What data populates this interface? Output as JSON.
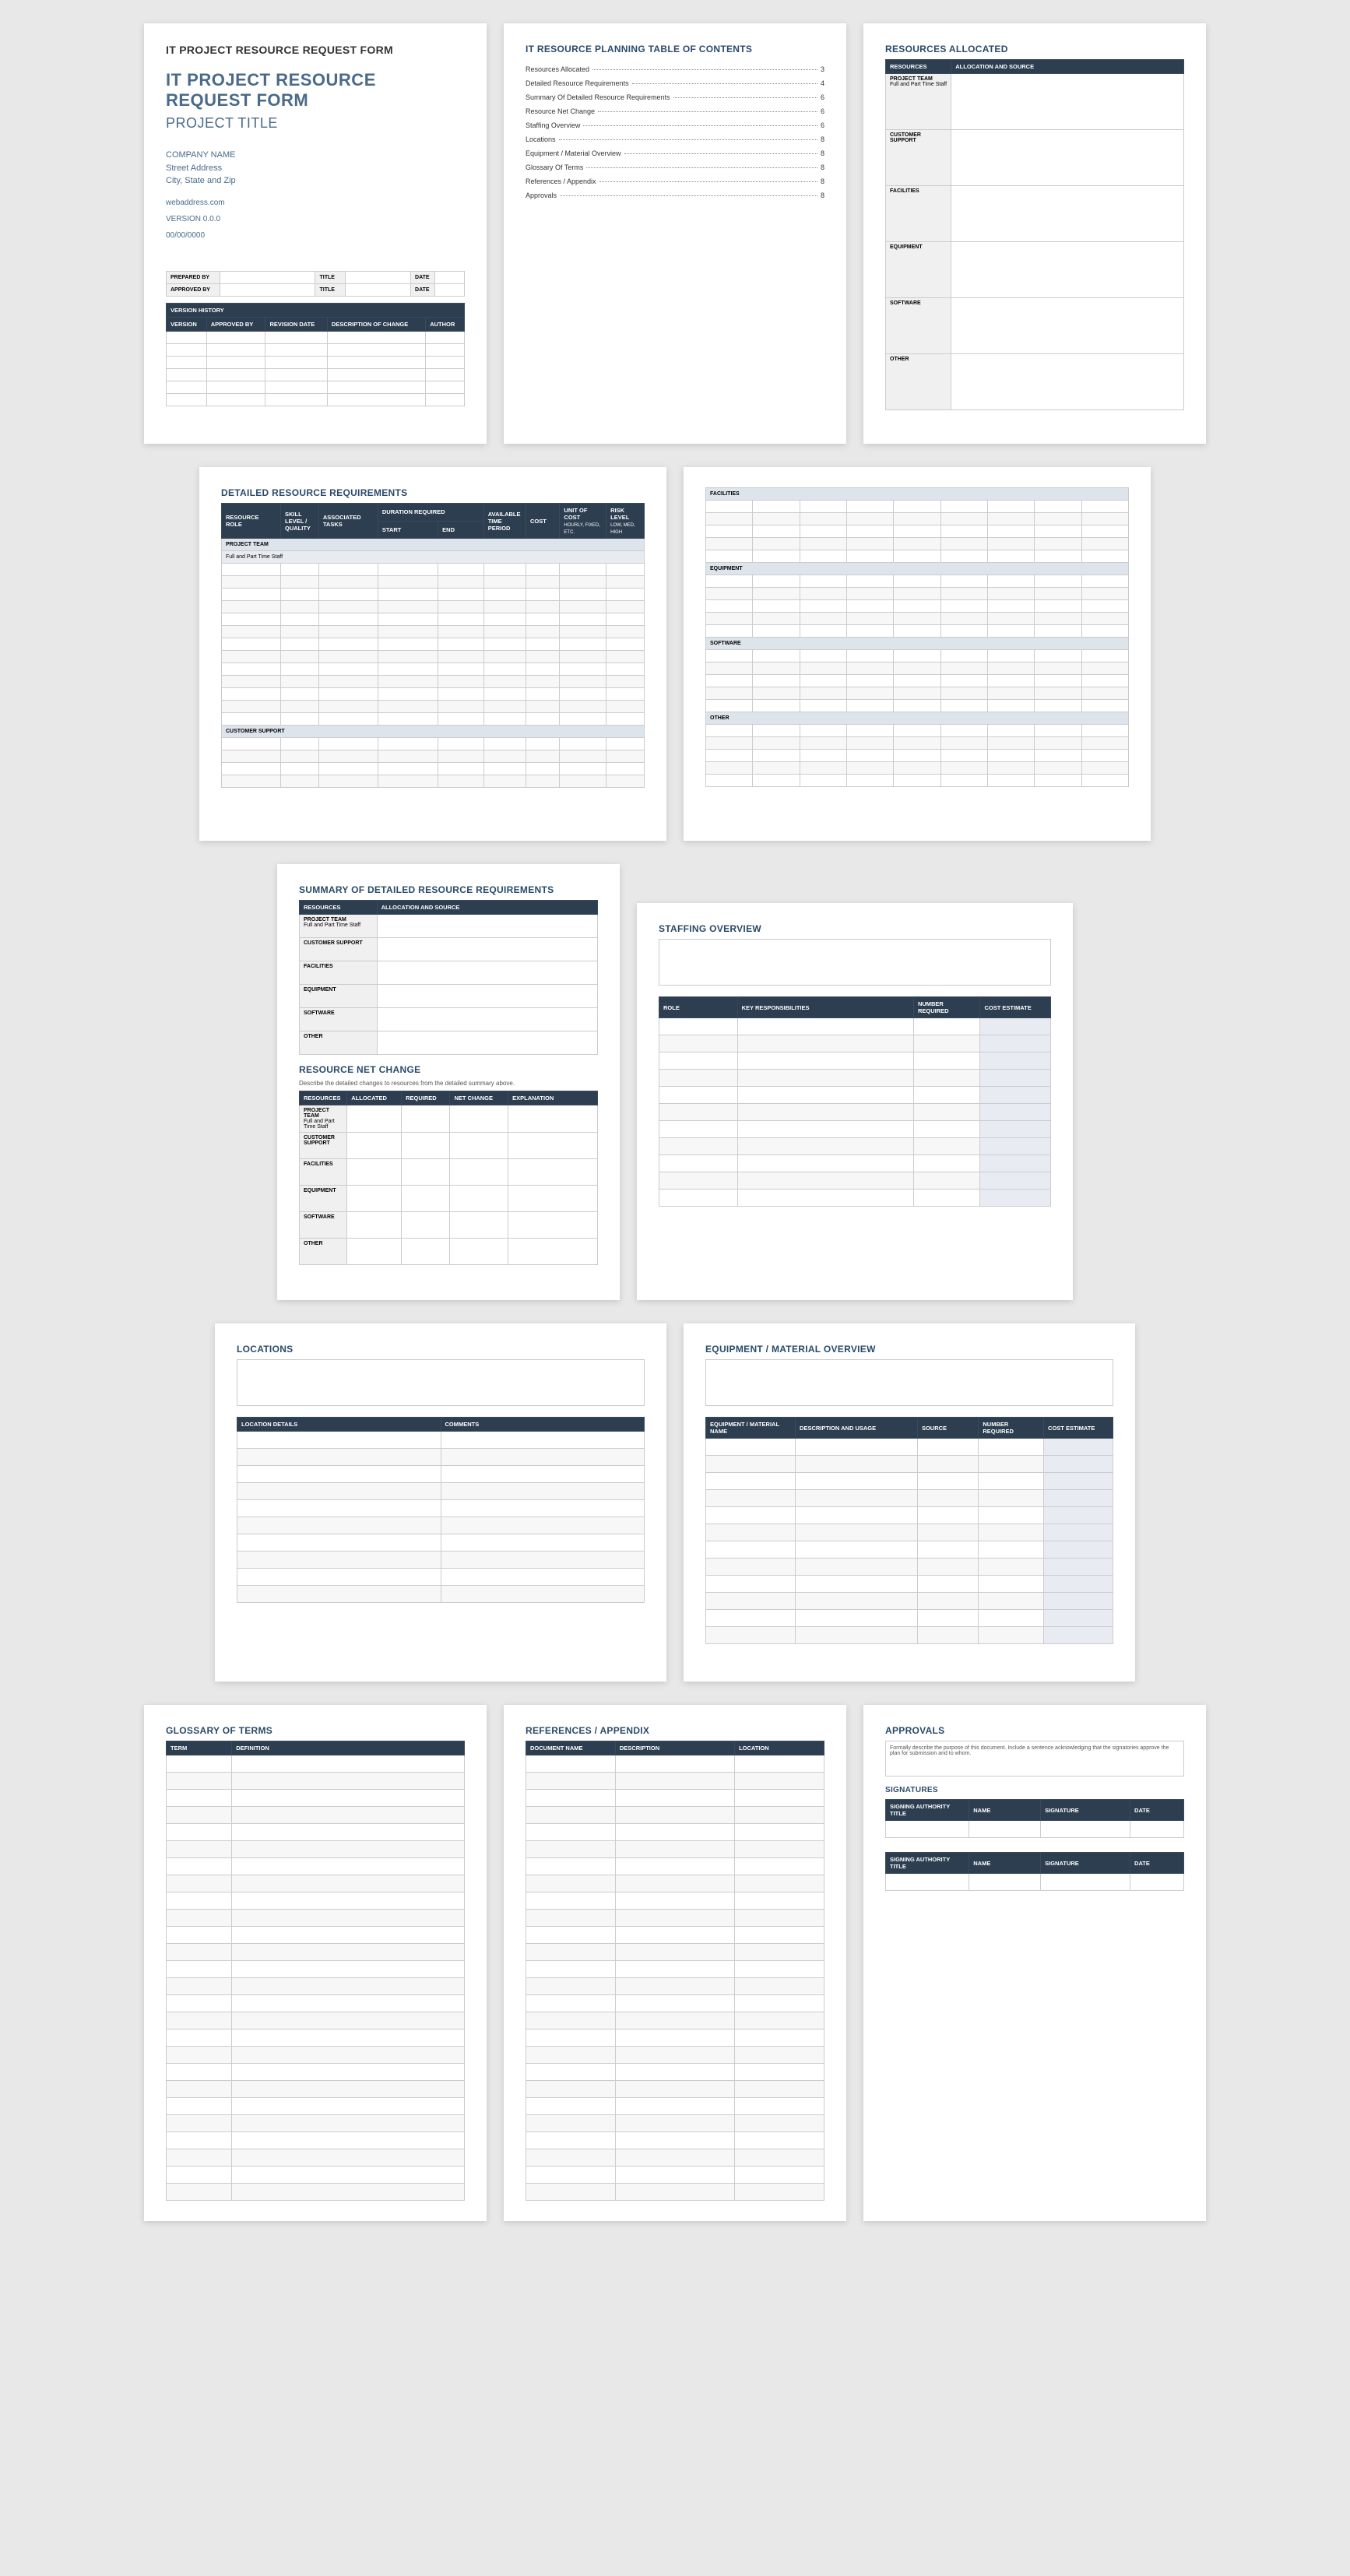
{
  "p1": {
    "head": "IT PROJECT RESOURCE REQUEST FORM",
    "title": "IT PROJECT RESOURCE REQUEST FORM",
    "project": "PROJECT TITLE",
    "company": "COMPANY NAME",
    "street": "Street Address",
    "city": "City, State and Zip",
    "web": "webaddress.com",
    "version": "VERSION 0.0.0",
    "date": "00/00/0000",
    "prep": "PREPARED BY",
    "t1": "TITLE",
    "d1": "DATE",
    "appr": "APPROVED BY",
    "t2": "TITLE",
    "d2": "DATE",
    "vh": "VERSION HISTORY",
    "vh_cols": [
      "VERSION",
      "APPROVED BY",
      "REVISION DATE",
      "DESCRIPTION OF CHANGE",
      "AUTHOR"
    ]
  },
  "p2": {
    "title": "IT RESOURCE PLANNING TABLE OF CONTENTS",
    "items": [
      {
        "t": "Resources Allocated",
        "n": "3"
      },
      {
        "t": "Detailed Resource Requirements",
        "n": "4"
      },
      {
        "t": "Summary Of Detailed Resource Requirements",
        "n": "6"
      },
      {
        "t": "Resource Net Change",
        "n": "6"
      },
      {
        "t": "Staffing Overview",
        "n": "6"
      },
      {
        "t": "Locations",
        "n": "8"
      },
      {
        "t": "Equipment / Material Overview",
        "n": "8"
      },
      {
        "t": "Glossary Of Terms",
        "n": "8"
      },
      {
        "t": "References / Appendix",
        "n": "8"
      },
      {
        "t": "Approvals",
        "n": "8"
      }
    ]
  },
  "p3": {
    "title": "RESOURCES ALLOCATED",
    "c1": "RESOURCES",
    "c2": "ALLOCATION AND SOURCE",
    "rows": [
      "PROJECT TEAM",
      "CUSTOMER SUPPORT",
      "FACILITIES",
      "EQUIPMENT",
      "SOFTWARE",
      "OTHER"
    ],
    "sub": "Full and Part Time Staff"
  },
  "p4": {
    "title": "DETAILED RESOURCE REQUIREMENTS",
    "cols": [
      "RESOURCE ROLE",
      "SKILL LEVEL / QUALITY",
      "ASSOCIATED TASKS",
      "DURATION REQUIRED",
      "",
      "AVAILABLE TIME PERIOD",
      "COST",
      "UNIT OF COST",
      "RISK LEVEL"
    ],
    "sub_start": "START",
    "sub_end": "END",
    "unit_hint": "Hourly, Fixed, etc.",
    "risk_hint": "Low, Med, High",
    "g1": "PROJECT TEAM",
    "g1s": "Full and Part Time Staff",
    "g2": "CUSTOMER SUPPORT"
  },
  "p5": {
    "g1": "FACILITIES",
    "g2": "EQUIPMENT",
    "g3": "SOFTWARE",
    "g4": "OTHER"
  },
  "p6": {
    "t1": "SUMMARY OF DETAILED RESOURCE REQUIREMENTS",
    "c1": "RESOURCES",
    "c2": "ALLOCATION AND SOURCE",
    "rows": [
      "PROJECT TEAM",
      "CUSTOMER SUPPORT",
      "FACILITIES",
      "EQUIPMENT",
      "SOFTWARE",
      "OTHER"
    ],
    "sub": "Full and Part Time Staff",
    "t2": "RESOURCE NET CHANGE",
    "t2s": "Describe the detailed changes to resources from the detailed summary above.",
    "nc": [
      "RESOURCES",
      "ALLOCATED",
      "REQUIRED",
      "NET CHANGE",
      "EXPLANATION"
    ],
    "ncrows": [
      "PROJECT TEAM",
      "CUSTOMER SUPPORT",
      "FACILITIES",
      "EQUIPMENT",
      "SOFTWARE",
      "OTHER"
    ],
    "ncsub": "Full and Part Time Staff"
  },
  "p7": {
    "title": "STAFFING OVERVIEW",
    "cols": [
      "ROLE",
      "KEY RESPONSIBILITIES",
      "NUMBER REQUIRED",
      "COST ESTIMATE"
    ]
  },
  "p8": {
    "title": "LOCATIONS",
    "cols": [
      "LOCATION DETAILS",
      "COMMENTS"
    ]
  },
  "p9": {
    "title": "EQUIPMENT / MATERIAL OVERVIEW",
    "cols": [
      "EQUIPMENT / MATERIAL NAME",
      "DESCRIPTION AND USAGE",
      "SOURCE",
      "NUMBER REQUIRED",
      "COST ESTIMATE"
    ]
  },
  "p10": {
    "title": "GLOSSARY OF TERMS",
    "cols": [
      "TERM",
      "DEFINITION"
    ]
  },
  "p11": {
    "title": "REFERENCES / APPENDIX",
    "cols": [
      "DOCUMENT NAME",
      "DESCRIPTION",
      "LOCATION"
    ]
  },
  "p12": {
    "title": "APPROVALS",
    "lead": "Formally describe the purpose of this document. Include a sentence acknowledging that the signatories approve the plan for submission and to whom.",
    "sig": "SIGNATURES",
    "cols": [
      "SIGNING AUTHORITY TITLE",
      "NAME",
      "SIGNATURE",
      "DATE"
    ]
  }
}
